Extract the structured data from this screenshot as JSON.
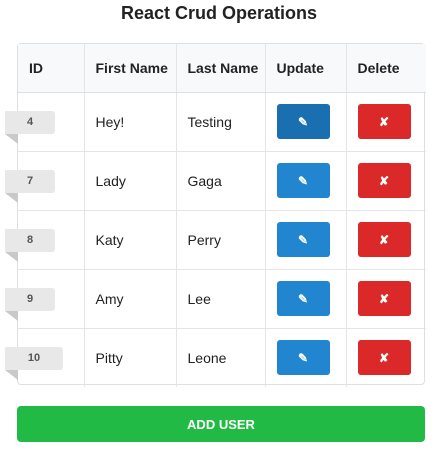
{
  "title": "React Crud Operations",
  "columns": [
    "ID",
    "First Name",
    "Last Name",
    "Update",
    "Delete"
  ],
  "rows": [
    {
      "id": "4",
      "first_name": "Hey!",
      "last_name": "Testing",
      "update_icon": "pencil-icon",
      "delete_icon": "cross-icon"
    },
    {
      "id": "7",
      "first_name": "Lady",
      "last_name": "Gaga",
      "update_icon": "pencil-icon",
      "delete_icon": "cross-icon"
    },
    {
      "id": "8",
      "first_name": "Katy",
      "last_name": "Perry",
      "update_icon": "pencil-icon",
      "delete_icon": "cross-icon"
    },
    {
      "id": "9",
      "first_name": "Amy",
      "last_name": "Lee",
      "update_icon": "pencil-icon",
      "delete_icon": "cross-icon"
    },
    {
      "id": "10",
      "first_name": "Pitty",
      "last_name": "Leone",
      "update_icon": "pencil-icon",
      "delete_icon": "cross-icon"
    }
  ],
  "glyphs": {
    "update": "✎",
    "delete": "✘"
  },
  "add_button_label": "ADD USER",
  "colors": {
    "update_button": "#2185d0",
    "delete_button": "#db2828",
    "add_button": "#21ba45",
    "id_ribbon": "#e8e8e8"
  }
}
